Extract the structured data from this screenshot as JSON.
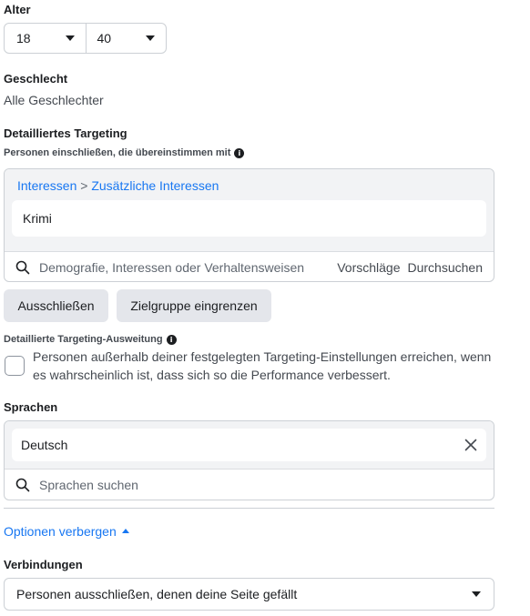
{
  "age": {
    "heading": "Alter",
    "min": "18",
    "max": "40"
  },
  "gender": {
    "heading": "Geschlecht",
    "value": "Alle Geschlechter"
  },
  "detailed_targeting": {
    "heading": "Detailliertes Targeting",
    "include_label": "Personen einschließen, die übereinstimmen mit",
    "breadcrumb": {
      "part1": "Interessen",
      "separator": " > ",
      "part2": "Zusätzliche Interessen"
    },
    "selected_item": "Krimi",
    "search_placeholder": "Demografie, Interessen oder Verhaltensweisen",
    "suggestions_label": "Vorschläge",
    "browse_label": "Durchsuchen",
    "exclude_button": "Ausschließen",
    "narrow_button": "Zielgruppe eingrenzen"
  },
  "expansion": {
    "heading": "Detaillierte Targeting-Ausweitung",
    "checkbox_text": "Personen außerhalb deiner festgelegten Targeting-Einstellungen erreichen, wenn es wahrscheinlich ist, dass sich so die Performance verbessert."
  },
  "languages": {
    "heading": "Sprachen",
    "selected": "Deutsch",
    "search_placeholder": "Sprachen suchen"
  },
  "options": {
    "hide_label": "Optionen verbergen"
  },
  "connections": {
    "heading": "Verbindungen",
    "selected": "Personen ausschließen, denen deine Seite gefällt"
  },
  "colors": {
    "link": "#1877f2",
    "button_bg": "#e4e6eb",
    "box_bg": "#f2f3f5",
    "border": "#ccd0d5"
  }
}
